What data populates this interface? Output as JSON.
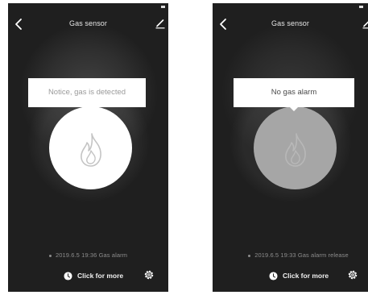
{
  "screens": [
    {
      "title": "Gas sensor",
      "bubble_text": "Notice, gas is detected",
      "state": "alarm",
      "circle_color": "#ffffff",
      "event_text": "2019.6.5 19:36 Gas alarm",
      "more_label": "Click for more"
    },
    {
      "title": "Gas sensor",
      "bubble_text": "No gas alarm",
      "state": "normal",
      "circle_color": "#a6a6a6",
      "event_text": "2019.6.5 19:33 Gas alarm release",
      "more_label": "Click for more"
    }
  ],
  "icons": {
    "back": "chevron-left-icon",
    "edit": "pencil-icon",
    "state": "flame-icon",
    "history": "clock-icon",
    "settings": "gear-icon"
  },
  "colors": {
    "background": "#1f1f1f",
    "bubble": "#ffffff",
    "text": "#e6e6e6"
  }
}
